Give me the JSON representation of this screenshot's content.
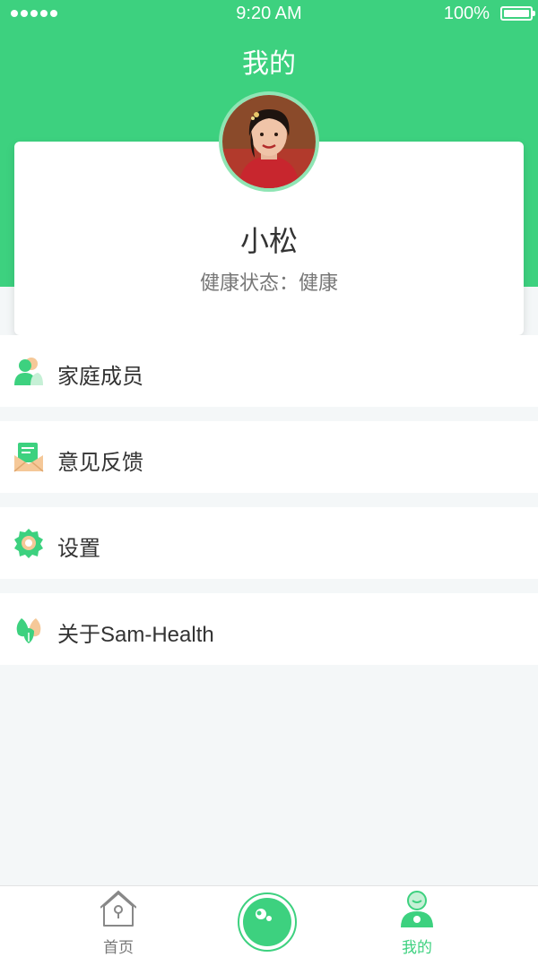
{
  "status_bar": {
    "time": "9:20 AM",
    "battery": "100%"
  },
  "header": {
    "title": "我的"
  },
  "profile": {
    "name": "小松",
    "health_status": "健康状态：健康"
  },
  "menu": [
    {
      "label": "家庭成员",
      "icon": "family-members-icon"
    },
    {
      "label": "意见反馈",
      "icon": "feedback-icon"
    },
    {
      "label": "设置",
      "icon": "settings-gear-icon"
    },
    {
      "label": "关于Sam-Health",
      "icon": "about-icon"
    }
  ],
  "tabbar": {
    "home_label": "首页",
    "center_icon": "health-check-icon",
    "mine_label": "我的"
  },
  "colors": {
    "accent": "#3dd17f",
    "background": "#f4f7f8"
  }
}
